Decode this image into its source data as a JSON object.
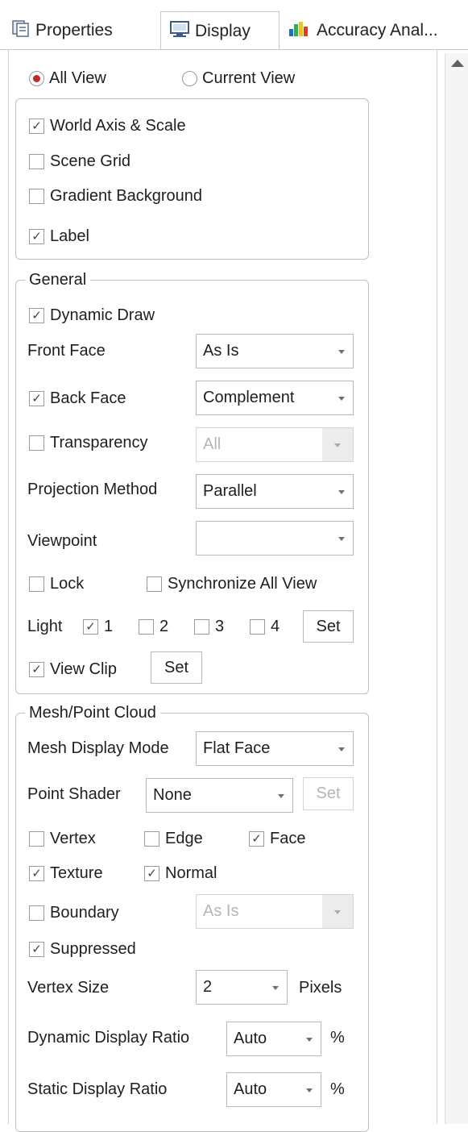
{
  "tabs": [
    {
      "label": "Properties",
      "icon": "properties-icon",
      "active": false
    },
    {
      "label": "Display",
      "icon": "monitor-icon",
      "active": true
    },
    {
      "label": "Accuracy Anal...",
      "icon": "chart-icon",
      "active": false
    }
  ],
  "view_mode": {
    "all_view": "All View",
    "current_view": "Current View",
    "selected": "all_view"
  },
  "scene": {
    "world_axis": "World Axis & Scale",
    "scene_grid": "Scene Grid",
    "gradient_background": "Gradient Background",
    "label": "Label"
  },
  "general": {
    "title": "General",
    "dynamic_draw": "Dynamic Draw",
    "front_face_label": "Front Face",
    "front_face_value": "As Is",
    "back_face_label": "Back Face",
    "back_face_value": "Complement",
    "transparency_label": "Transparency",
    "transparency_value": "All",
    "projection_label": "Projection Method",
    "projection_value": "Parallel",
    "viewpoint_label": "Viewpoint",
    "viewpoint_value": "",
    "lock": "Lock",
    "sync_all": "Synchronize All View",
    "light_label": "Light",
    "light_1": "1",
    "light_2": "2",
    "light_3": "3",
    "light_4": "4",
    "set": "Set",
    "view_clip": "View Clip"
  },
  "mesh": {
    "title": "Mesh/Point Cloud",
    "display_mode_label": "Mesh Display Mode",
    "display_mode_value": "Flat Face",
    "point_shader_label": "Point Shader",
    "point_shader_value": "None",
    "set": "Set",
    "vertex": "Vertex",
    "edge": "Edge",
    "face": "Face",
    "texture": "Texture",
    "normal": "Normal",
    "boundary": "Boundary",
    "boundary_value": "As Is",
    "suppressed": "Suppressed",
    "vertex_size_label": "Vertex Size",
    "vertex_size_value": "2",
    "pixels": "Pixels",
    "dyn_ratio_label": "Dynamic Display Ratio",
    "dyn_ratio_value": "Auto",
    "static_ratio_label": "Static Display Ratio",
    "static_ratio_value": "Auto",
    "percent": "%"
  }
}
